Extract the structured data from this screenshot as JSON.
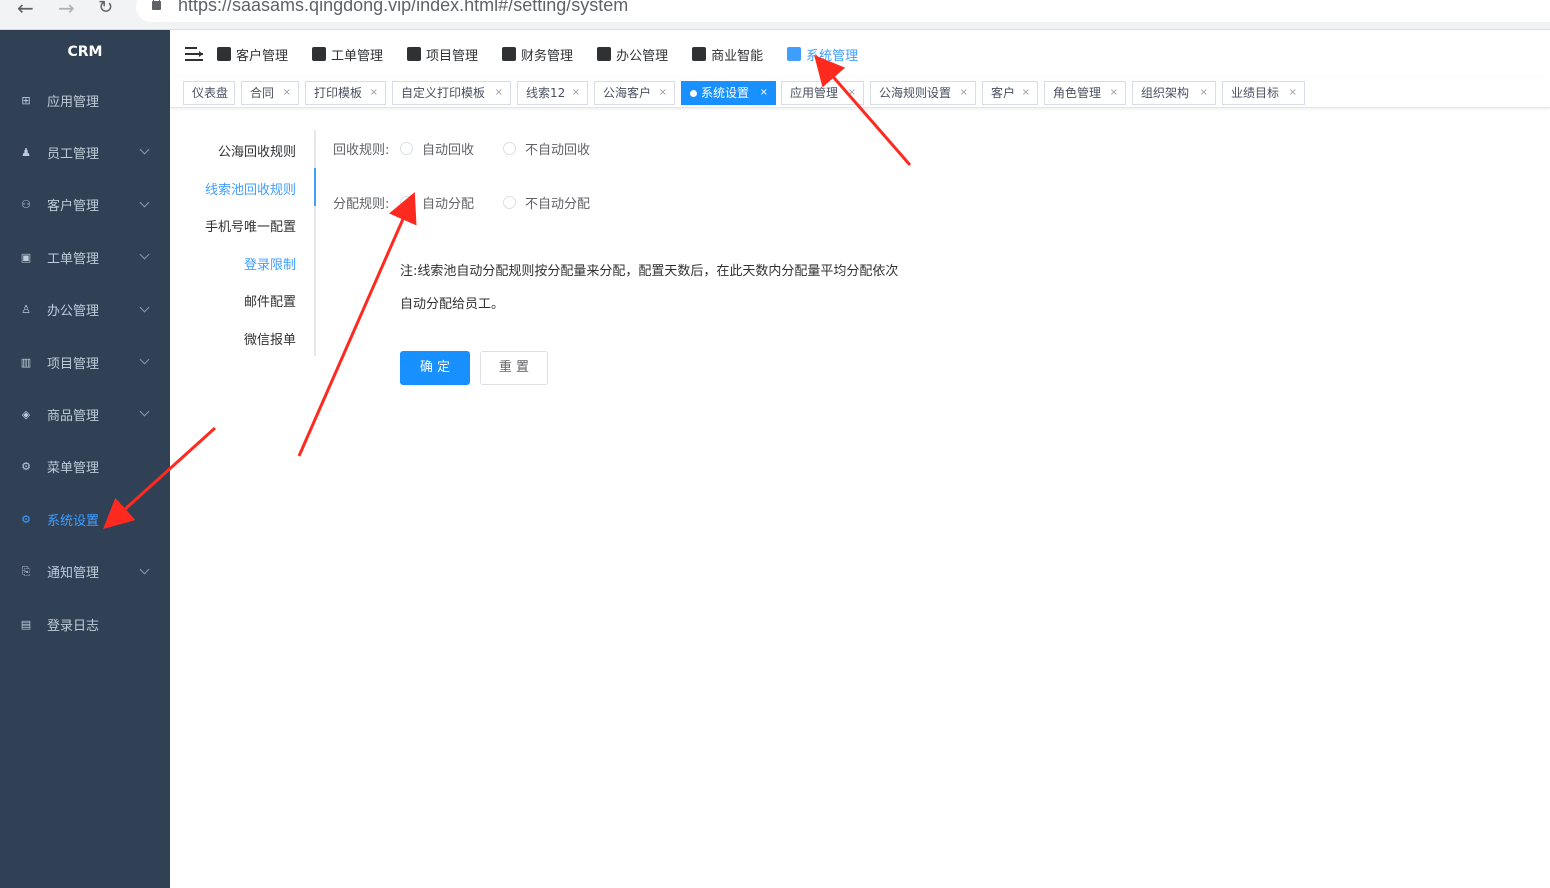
{
  "browser": {
    "url": "https://saasams.qingdong.vip/index.html#/setting/system"
  },
  "sidebar": {
    "logo": "CRM",
    "items": [
      {
        "label": "应用管理",
        "icon": "grid-icon",
        "expandable": false,
        "active": false
      },
      {
        "label": "员工管理",
        "icon": "user-icon",
        "expandable": true,
        "active": false
      },
      {
        "label": "客户管理",
        "icon": "customers-icon",
        "expandable": true,
        "active": false
      },
      {
        "label": "工单管理",
        "icon": "clipboard-icon",
        "expandable": true,
        "active": false
      },
      {
        "label": "办公管理",
        "icon": "stamp-icon",
        "expandable": true,
        "active": false
      },
      {
        "label": "项目管理",
        "icon": "bars-icon",
        "expandable": true,
        "active": false
      },
      {
        "label": "商品管理",
        "icon": "box-icon",
        "expandable": true,
        "active": false
      },
      {
        "label": "菜单管理",
        "icon": "gear-icon",
        "expandable": false,
        "active": false
      },
      {
        "label": "系统设置",
        "icon": "settings-icon",
        "expandable": false,
        "active": true
      },
      {
        "label": "通知管理",
        "icon": "notify-icon",
        "expandable": true,
        "active": false
      },
      {
        "label": "登录日志",
        "icon": "log-icon",
        "expandable": false,
        "active": false
      }
    ]
  },
  "topnav": {
    "items": [
      {
        "label": "客户管理",
        "icon": "person-icon"
      },
      {
        "label": "工单管理",
        "icon": "clipboard-icon"
      },
      {
        "label": "项目管理",
        "icon": "books-icon"
      },
      {
        "label": "财务管理",
        "icon": "finance-icon"
      },
      {
        "label": "办公管理",
        "icon": "office-icon"
      },
      {
        "label": "商业智能",
        "icon": "bi-icon"
      },
      {
        "label": "系统管理",
        "icon": "wrench-icon",
        "active": true
      }
    ]
  },
  "tags": [
    {
      "label": "仪表盘",
      "closable": false
    },
    {
      "label": "合同",
      "closable": true
    },
    {
      "label": "打印模板",
      "closable": true
    },
    {
      "label": "自定义打印模板",
      "closable": true
    },
    {
      "label": "线索12",
      "closable": true
    },
    {
      "label": "公海客户",
      "closable": true
    },
    {
      "label": "系统设置",
      "closable": true,
      "active": true
    },
    {
      "label": "应用管理",
      "closable": true
    },
    {
      "label": "公海规则设置",
      "closable": true
    },
    {
      "label": "客户",
      "closable": true
    },
    {
      "label": "角色管理",
      "closable": true
    },
    {
      "label": "组织架构",
      "closable": true
    },
    {
      "label": "业绩目标",
      "closable": true
    }
  ],
  "settings_menu": {
    "items": [
      {
        "label": "公海回收规则"
      },
      {
        "label": "线索池回收规则",
        "active": true
      },
      {
        "label": "手机号唯一配置"
      },
      {
        "label": "登录限制",
        "link": true
      },
      {
        "label": "邮件配置"
      },
      {
        "label": "微信报单"
      }
    ]
  },
  "form": {
    "recycle_label": "回收规则:",
    "recycle_options": [
      "自动回收",
      "不自动回收"
    ],
    "assign_label": "分配规则:",
    "assign_options": [
      "自动分配",
      "不自动分配"
    ],
    "note_line1": "注:线索池自动分配规则按分配量来分配，配置天数后，在此天数内分配量平均分配依次",
    "note_line2": "自动分配给员工。",
    "confirm_label": "确 定",
    "reset_label": "重 置"
  },
  "colors": {
    "sidebar_bg": "#304156",
    "accent": "#409eff",
    "primary_button": "#1890ff",
    "annotation_arrow": "#ff2a1f"
  }
}
